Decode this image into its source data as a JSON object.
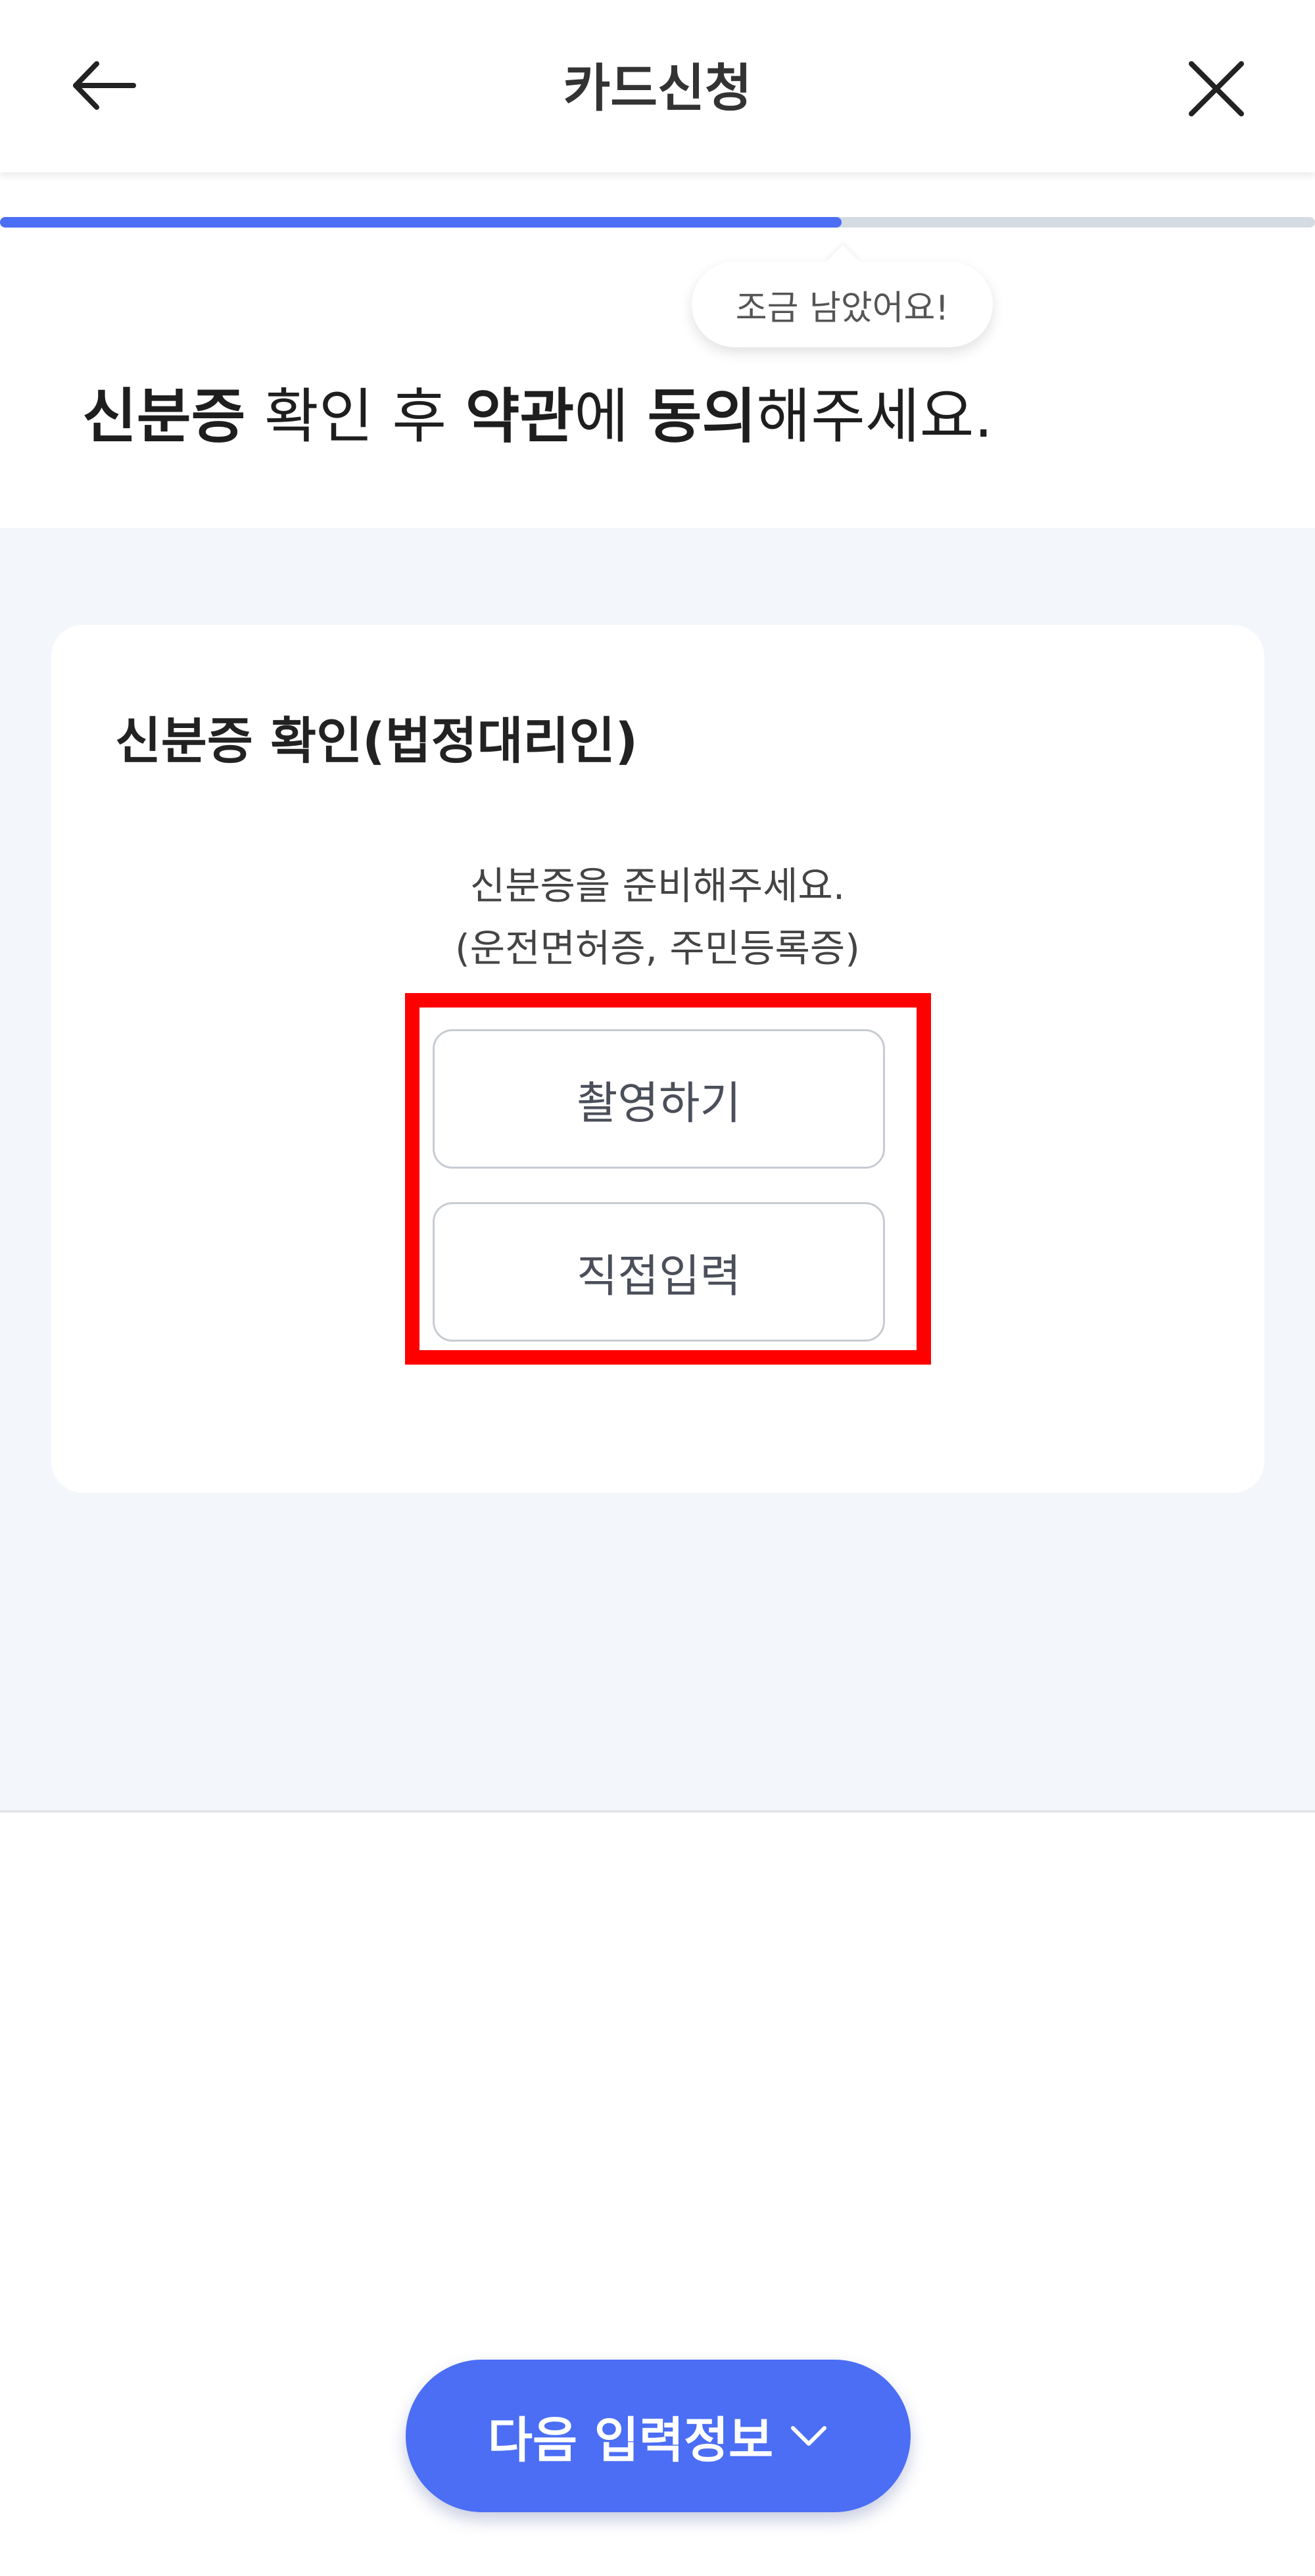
{
  "header": {
    "title": "카드신청",
    "back_icon": "arrow-left-icon",
    "close_icon": "close-icon"
  },
  "progress": {
    "fraction": 0.64,
    "tooltip": "조금 남았어요!",
    "fill_color": "#4b6ef5",
    "track_color": "#d5dbe3"
  },
  "headline": {
    "part1": "신분증",
    "part2": " 확인 후 ",
    "part3": "약관",
    "part4": "에 ",
    "part5": "동의",
    "part6": "해주세요."
  },
  "card": {
    "title": "신분증 확인(법정대리인)",
    "desc_line1": "신분증을 준비해주세요.",
    "desc_line2": "(운전면허증, 주민등록증)",
    "photo_button": "촬영하기",
    "manual_button": "직접입력"
  },
  "footer": {
    "next_button": "다음 입력정보",
    "next_icon": "chevron-down-icon",
    "button_color": "#4b6ef5"
  },
  "annotation": {
    "highlight_color": "#ff0000"
  }
}
